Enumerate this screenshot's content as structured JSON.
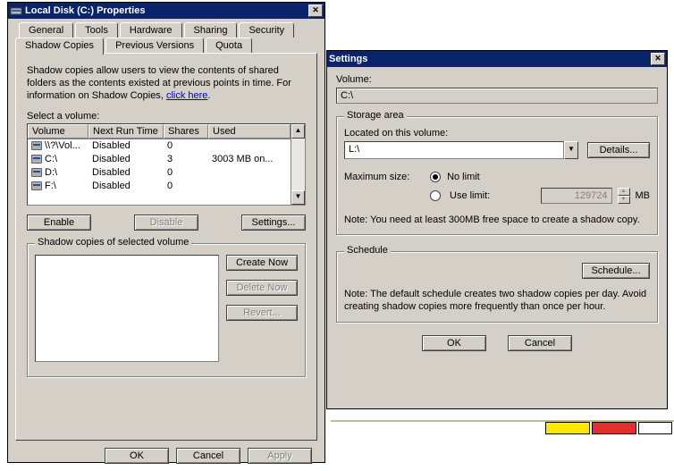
{
  "props": {
    "title": "Local Disk (C:) Properties",
    "tabs_row1": [
      "General",
      "Tools",
      "Hardware",
      "Sharing",
      "Security"
    ],
    "tabs_row2": [
      "Shadow Copies",
      "Previous Versions",
      "Quota"
    ],
    "active_tab": "Shadow Copies",
    "desc1": "Shadow copies allow users to view the contents of shared folders as the contents existed at previous points in time. For information on Shadow Copies, ",
    "desc_link": "click here",
    "select_label": "Select a volume:",
    "columns": [
      "Volume",
      "Next Run Time",
      "Shares",
      "Used"
    ],
    "rows": [
      {
        "vol": "\\\\?\\Vol...",
        "next": "Disabled",
        "shares": "0",
        "used": ""
      },
      {
        "vol": "C:\\",
        "next": "Disabled",
        "shares": "3",
        "used": "3003 MB on..."
      },
      {
        "vol": "D:\\",
        "next": "Disabled",
        "shares": "0",
        "used": ""
      },
      {
        "vol": "F:\\",
        "next": "Disabled",
        "shares": "0",
        "used": ""
      }
    ],
    "btn_enable": "Enable",
    "btn_disable": "Disable",
    "btn_settings": "Settings...",
    "group_label": "Shadow copies of selected volume",
    "btn_create": "Create Now",
    "btn_delete": "Delete Now",
    "btn_revert": "Revert...",
    "ok": "OK",
    "cancel": "Cancel",
    "apply": "Apply"
  },
  "settings": {
    "title": "Settings",
    "volume_label": "Volume:",
    "volume_value": "C:\\",
    "storage_label": "Storage area",
    "located_label": "Located on this volume:",
    "located_value": "L:\\",
    "details": "Details...",
    "maxsize_label": "Maximum size:",
    "opt_nolimit": "No limit",
    "opt_uselimit": "Use limit:",
    "limit_value": "129724",
    "mb": "MB",
    "storage_note": "Note: You need at least 300MB free space to create a shadow copy.",
    "schedule_label": "Schedule",
    "schedule_btn": "Schedule...",
    "schedule_note": "Note: The default schedule creates two shadow copies per day. Avoid creating shadow copies more frequently than once per hour.",
    "ok": "OK",
    "cancel": "Cancel"
  }
}
